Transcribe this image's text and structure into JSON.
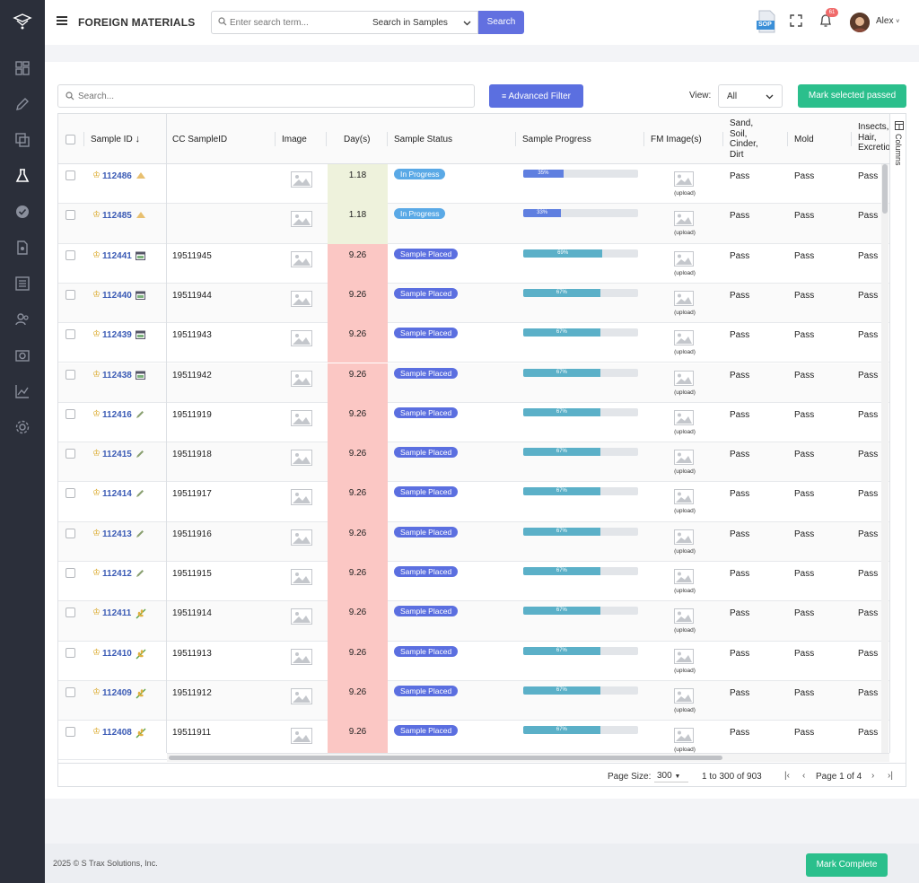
{
  "header": {
    "title": "FOREIGN MATERIALS",
    "search_placeholder": "Enter search term...",
    "search_scope": "Search in Samples",
    "search_button": "Search",
    "notification_count": "61",
    "user_name": "Alex",
    "sop_label": "SOP"
  },
  "toolbar": {
    "search_placeholder": "Search...",
    "advanced_filter": "Advanced Filter",
    "view_label": "View:",
    "view_value": "All",
    "mark_passed": "Mark selected passed"
  },
  "columns": [
    "Sample ID",
    "CC SampleID",
    "Image",
    "Day(s)",
    "Sample Status",
    "Sample Progress",
    "FM Image(s)",
    "Sand, Soil, Cinder, Dirt",
    "Mold",
    "Insects, Hair, Excretion"
  ],
  "column_lines": {
    "sand": [
      "Sand,",
      "Soil,",
      "Cinder,",
      "Dirt"
    ],
    "insects": [
      "Insects,",
      "Hair,",
      "Excretion"
    ]
  },
  "columns_tab_label": "Columns",
  "upload_label": "(upload)",
  "rows": [
    {
      "id": "112486",
      "cc": "",
      "days": "1.18",
      "status": "In Progress",
      "progress": 35,
      "progress_label": "35%",
      "sand": "Pass",
      "mold": "Pass",
      "insects": "Pass",
      "type_icon": "triangle"
    },
    {
      "id": "112485",
      "cc": "",
      "days": "1.18",
      "status": "In Progress",
      "progress": 33,
      "progress_label": "33%",
      "sand": "Pass",
      "mold": "Pass",
      "insects": "Pass",
      "type_icon": "triangle"
    },
    {
      "id": "112441",
      "cc": "19511945",
      "days": "9.26",
      "status": "Sample Placed",
      "progress": 69,
      "progress_label": "69%",
      "sand": "Pass",
      "mold": "Pass",
      "insects": "Pass",
      "type_icon": "calendar"
    },
    {
      "id": "112440",
      "cc": "19511944",
      "days": "9.26",
      "status": "Sample Placed",
      "progress": 67,
      "progress_label": "67%",
      "sand": "Pass",
      "mold": "Pass",
      "insects": "Pass",
      "type_icon": "calendar"
    },
    {
      "id": "112439",
      "cc": "19511943",
      "days": "9.26",
      "status": "Sample Placed",
      "progress": 67,
      "progress_label": "67%",
      "sand": "Pass",
      "mold": "Pass",
      "insects": "Pass",
      "type_icon": "calendar"
    },
    {
      "id": "112438",
      "cc": "19511942",
      "days": "9.26",
      "status": "Sample Placed",
      "progress": 67,
      "progress_label": "67%",
      "sand": "Pass",
      "mold": "Pass",
      "insects": "Pass",
      "type_icon": "calendar"
    },
    {
      "id": "112416",
      "cc": "19511919",
      "days": "9.26",
      "status": "Sample Placed",
      "progress": 67,
      "progress_label": "67%",
      "sand": "Pass",
      "mold": "Pass",
      "insects": "Pass",
      "type_icon": "pencil"
    },
    {
      "id": "112415",
      "cc": "19511918",
      "days": "9.26",
      "status": "Sample Placed",
      "progress": 67,
      "progress_label": "67%",
      "sand": "Pass",
      "mold": "Pass",
      "insects": "Pass",
      "type_icon": "pencil"
    },
    {
      "id": "112414",
      "cc": "19511917",
      "days": "9.26",
      "status": "Sample Placed",
      "progress": 67,
      "progress_label": "67%",
      "sand": "Pass",
      "mold": "Pass",
      "insects": "Pass",
      "type_icon": "pencil"
    },
    {
      "id": "112413",
      "cc": "19511916",
      "days": "9.26",
      "status": "Sample Placed",
      "progress": 67,
      "progress_label": "67%",
      "sand": "Pass",
      "mold": "Pass",
      "insects": "Pass",
      "type_icon": "pencil"
    },
    {
      "id": "112412",
      "cc": "19511915",
      "days": "9.26",
      "status": "Sample Placed",
      "progress": 67,
      "progress_label": "67%",
      "sand": "Pass",
      "mold": "Pass",
      "insects": "Pass",
      "type_icon": "pencil"
    },
    {
      "id": "112411",
      "cc": "19511914",
      "days": "9.26",
      "status": "Sample Placed",
      "progress": 67,
      "progress_label": "67%",
      "sand": "Pass",
      "mold": "Pass",
      "insects": "Pass",
      "type_icon": "wheat"
    },
    {
      "id": "112410",
      "cc": "19511913",
      "days": "9.26",
      "status": "Sample Placed",
      "progress": 67,
      "progress_label": "67%",
      "sand": "Pass",
      "mold": "Pass",
      "insects": "Pass",
      "type_icon": "wheat"
    },
    {
      "id": "112409",
      "cc": "19511912",
      "days": "9.26",
      "status": "Sample Placed",
      "progress": 67,
      "progress_label": "67%",
      "sand": "Pass",
      "mold": "Pass",
      "insects": "Pass",
      "type_icon": "wheat"
    },
    {
      "id": "112408",
      "cc": "19511911",
      "days": "9.26",
      "status": "Sample Placed",
      "progress": 67,
      "progress_label": "67%",
      "sand": "Pass",
      "mold": "Pass",
      "insects": "Pass",
      "type_icon": "wheat"
    }
  ],
  "pager": {
    "page_size_label": "Page Size:",
    "page_size": "300",
    "range": "1 to 300 of 903",
    "page": "Page 1 of 4"
  },
  "footer": {
    "copyright": "2025 © S Trax Solutions, Inc.",
    "mark_complete": "Mark Complete"
  },
  "colors": {
    "sidebar": "#2b2f3a",
    "primary": "#5b6fe0",
    "success": "#2bbf8c",
    "days_recent": "#eef2dc",
    "days_overdue": "#fbc7c4"
  },
  "sidebar_icons": [
    "dashboard-icon",
    "pencil-icon",
    "copy-icon",
    "flask-icon",
    "verified-icon",
    "file-icon",
    "list-icon",
    "users-icon",
    "camera-icon",
    "chart-icon",
    "gear-icon"
  ]
}
